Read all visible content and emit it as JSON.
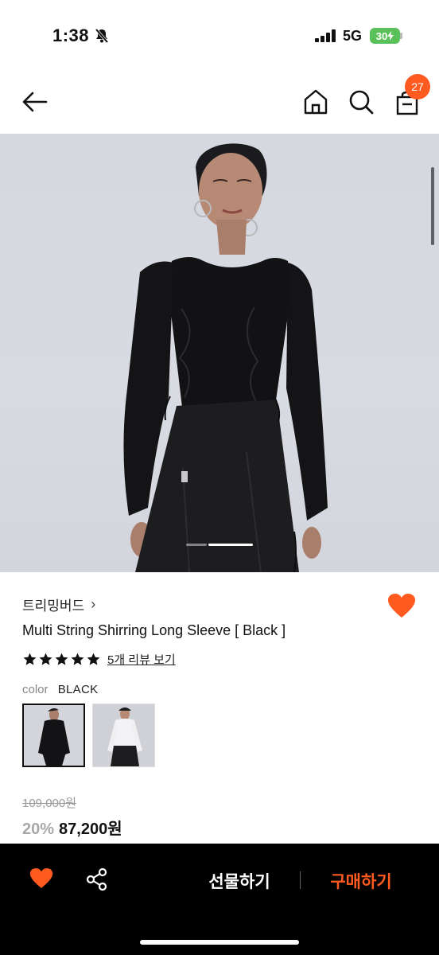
{
  "status_bar": {
    "time": "1:38",
    "network": "5G",
    "battery": "30"
  },
  "nav": {
    "cart_count": "27"
  },
  "product": {
    "brand": "트리밍버드",
    "brand_chevron": "›",
    "title": "Multi String Shirring Long Sleeve [ Black ]",
    "rating_stars": 5,
    "review_link": "5개 리뷰 보기",
    "color_label": "color",
    "color_value": "BLACK",
    "swatches": [
      "black",
      "white"
    ],
    "original_price": "109,000원",
    "discount": "20%",
    "sale_price": "87,200원"
  },
  "bottom_bar": {
    "gift_label": "선물하기",
    "buy_label": "구매하기"
  },
  "colors": {
    "accent": "#ff5a1f",
    "bottom_bar": "#000000"
  },
  "icons": [
    "mute-icon",
    "signal-icon",
    "back-arrow-icon",
    "home-icon",
    "search-icon",
    "shopping-bag-icon",
    "heart-icon",
    "star-icon",
    "share-icon"
  ]
}
